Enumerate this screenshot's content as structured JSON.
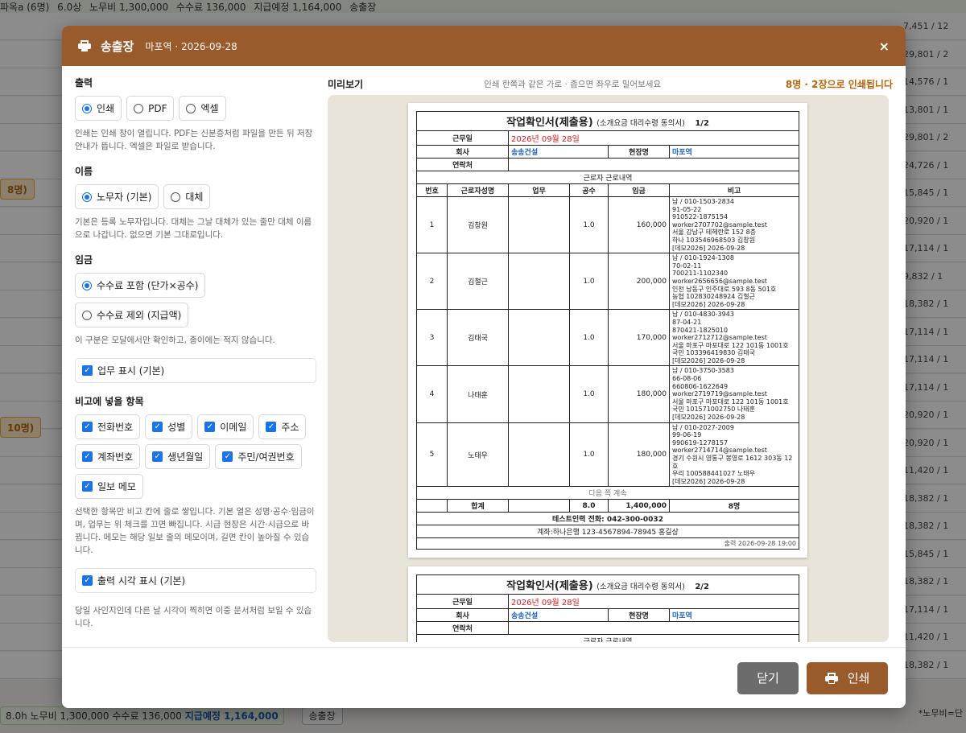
{
  "background": {
    "top_bar": [
      "파옥a (6명)",
      "6.0상",
      "노무비 1,300,000",
      "수수료 136,000",
      "지급예정 1,164,000",
      "송출장"
    ],
    "row_numbers": [
      "7,451 / 12",
      "29,801 / 2",
      "14,576 / 1",
      "13,801 / 1",
      "29,801 / 2",
      "24,726 / 1",
      "15,845 / 1",
      "20,920 / 1",
      "17,114 / 1",
      "9,832 / 1",
      "18,382 / 1",
      "17,114 / 1",
      "17,114 / 1",
      "17,114 / 1",
      "20,920 / 1",
      "20,920 / 1",
      "11,420 / 1",
      "18,382 / 1",
      "18,382 / 1",
      "15,845 / 1",
      "18,382 / 1",
      "17,114 / 1",
      "11,420 / 1",
      "18,382 / 1"
    ],
    "group_labels": [
      "8명)",
      "10명)"
    ],
    "bottom_bar": {
      "hours": "8.0h",
      "labor": "노무비 1,300,000",
      "fee": "수수료 136,000",
      "pay": "지급예정 1,164,000",
      "button": "송출장",
      "note": "*노무비=단"
    }
  },
  "modal": {
    "title": "송출장",
    "subtitle": "마포역 · 2026-09-28",
    "close": "×",
    "output": {
      "title": "출력",
      "options": [
        "인쇄",
        "PDF",
        "엑셀"
      ],
      "selected": 0,
      "help": "인쇄는 인쇄 창이 열립니다. PDF는 신분증처럼 파일을 만든 뒤 저장 안내가 뜹니다. 엑셀은 파일로 받습니다."
    },
    "name": {
      "title": "이름",
      "options": [
        "노무자 (기본)",
        "대체"
      ],
      "selected": 0,
      "help": "기본은 등록 노무자입니다. 대체는 그날 대체가 있는 줄만 대체 이름으로 나갑니다. 없으면 기본 그대로입니다."
    },
    "wage": {
      "title": "임금",
      "options": [
        "수수료 포함 (단가×공수)",
        "수수료 제외 (지급액)"
      ],
      "selected": 0,
      "help": "이 구분은 모달에서만 확인하고, 종이에는 적지 않습니다."
    },
    "show_work": "업무 표시 (기본)",
    "remarks": {
      "title": "비고에 넣을 항목",
      "items": [
        "전화번호",
        "성별",
        "이메일",
        "주소",
        "계좌번호",
        "생년월일",
        "주민/여권번호",
        "일보 메모"
      ],
      "help": "선택한 항목만 비고 칸에 줄로 쌓입니다. 기본 열은 성명·공수·임금이며, 업무는 위 체크를 끄면 빠집니다. 시급 현장은 시간·시급으로 바뀝니다. 메모는 해당 일보 줄의 메모이며, 길면 칸이 높아질 수 있습니다."
    },
    "show_time": "출력 시각 표시 (기본)",
    "show_time_help": "당일 사인지인데 다른 날 시각이 찍히면 이중 문서처럼 보일 수 있습니다.",
    "preview": {
      "label": "미리보기",
      "hint": "인쇄 한쪽과 같은 가로 · 좁으면 좌우로 밀어보세요",
      "pages": "8명 · 2장으로 인쇄됩니다"
    },
    "footer": {
      "close": "닫기",
      "print": "인쇄"
    }
  },
  "document": {
    "title": "작업확인서(제출용)",
    "subtitle": "(소개요금 대리수령 동의서)",
    "page1": "1/2",
    "page2": "2/2",
    "work_date_label": "근무일",
    "work_date": "2026년 09월 28일",
    "company_label": "회사",
    "company": "송송건설",
    "site_label": "현장명",
    "site": "마포역",
    "contact_label": "연락처",
    "section": "근로자 근로내역",
    "columns": [
      "번호",
      "근로자성명",
      "업무",
      "공수",
      "임금",
      "비고"
    ],
    "rows": [
      {
        "no": "1",
        "name": "김창원",
        "work": "",
        "days": "1.0",
        "wage": "160,000",
        "note": "남 / 010-1503-2834\n91-05-22\n910522-1875154\nworker2707702@sample.test\n서울 강남구 테헤란로 152 8층\n하나 103546968503 김창원\n[데모2026] 2026-09-28"
      },
      {
        "no": "2",
        "name": "김철근",
        "work": "",
        "days": "1.0",
        "wage": "200,000",
        "note": "남 / 010-1924-1308\n70-02-11\n700211-1102340\nworker2656656@sample.test\n인천 남동구 인주대로 593 8동 501호\n농협 102830248924 김철근\n[데모2026] 2026-09-28"
      },
      {
        "no": "3",
        "name": "김태국",
        "work": "",
        "days": "1.0",
        "wage": "170,000",
        "note": "남 / 010-4830-3943\n87-04-21\n870421-1825010\nworker2712712@sample.test\n서울 마포구 마포대로 122 101동 1001호\n국민 103396419830 김태국\n[데모2026] 2026-09-28"
      },
      {
        "no": "4",
        "name": "나태훈",
        "work": "",
        "days": "1.0",
        "wage": "180,000",
        "note": "남 / 010-3750-3583\n66-08-06\n660806-1622649\nworker2719719@sample.test\n서울 마포구 마포대로 122 101동 1001호\n국민 101571002750 나태훈\n[데모2026] 2026-09-28"
      },
      {
        "no": "5",
        "name": "노태우",
        "work": "",
        "days": "1.0",
        "wage": "180,000",
        "note": "남 / 010-2027-2009\n99-06-19\n990619-1278157\nworker2714714@sample.test\n경기 수원시 영통구 봉영로 1612 303동 12호\n우리 100588441027 노태우\n[데모2026] 2026-09-28"
      }
    ],
    "continue": "다음 쪽 계속",
    "total_label": "합계",
    "total_days": "8.0",
    "total_wage": "1,400,000",
    "total_count": "8명",
    "phone": "테스트인력 전화: 042-300-0032",
    "account": "계좌:하나은행 123-4567894-78945 홍길상",
    "printed": "출력 2026-09-28 19:00"
  },
  "colors": {
    "header": "#9a5b2c",
    "accent": "#b4650b",
    "check": "#1a73e8",
    "close_button": "#6c6c6c"
  }
}
